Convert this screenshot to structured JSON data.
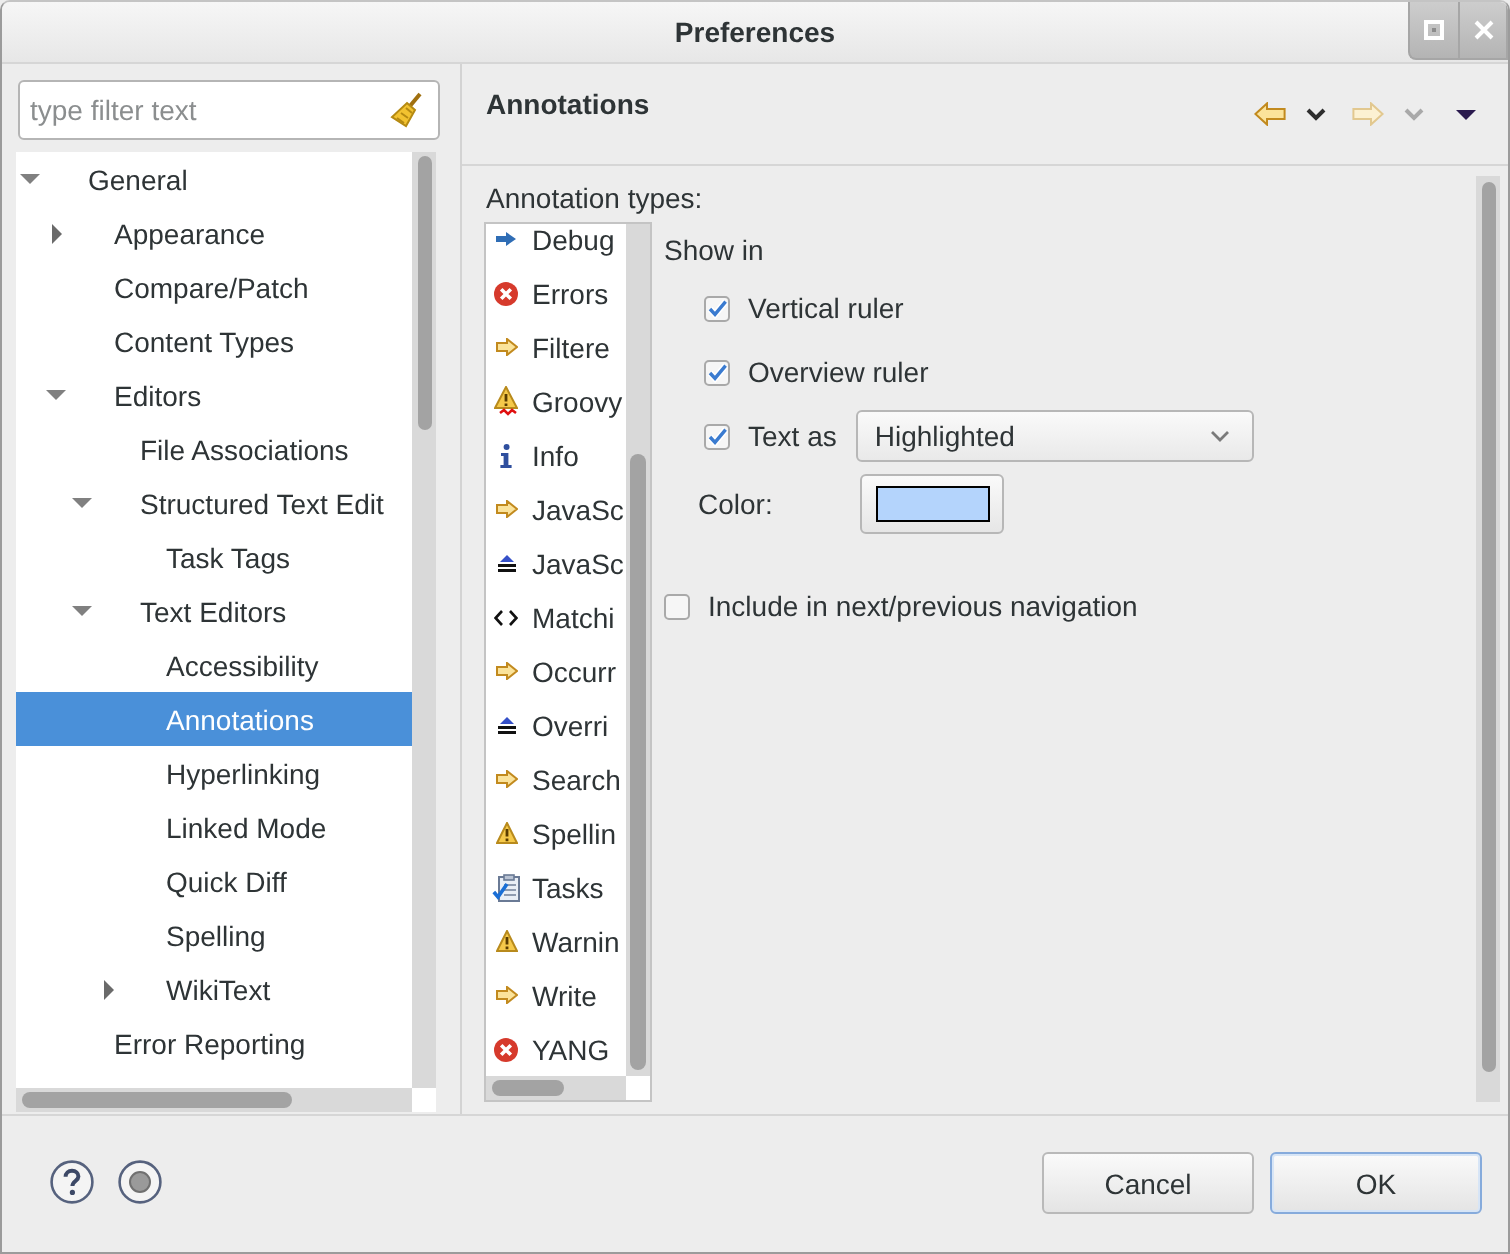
{
  "window": {
    "title": "Preferences"
  },
  "sidebar": {
    "filter": {
      "placeholder": "type filter text"
    },
    "tree": [
      {
        "label": "General",
        "expanded": true,
        "selected": false,
        "children": [
          {
            "label": "Appearance",
            "expanded": false,
            "selected": false
          },
          {
            "label": "Compare/Patch",
            "selected": false
          },
          {
            "label": "Content Types",
            "selected": false
          },
          {
            "label": "Editors",
            "expanded": true,
            "selected": false,
            "children": [
              {
                "label": "File Associations",
                "selected": false
              },
              {
                "label": "Structured Text Edit",
                "expanded": true,
                "selected": false,
                "children": [
                  {
                    "label": "Task Tags",
                    "selected": false
                  }
                ]
              },
              {
                "label": "Text Editors",
                "expanded": true,
                "selected": false,
                "children": [
                  {
                    "label": "Accessibility",
                    "selected": false
                  },
                  {
                    "label": "Annotations",
                    "selected": true
                  },
                  {
                    "label": "Hyperlinking",
                    "selected": false
                  },
                  {
                    "label": "Linked Mode",
                    "selected": false
                  },
                  {
                    "label": "Quick Diff",
                    "selected": false
                  },
                  {
                    "label": "Spelling",
                    "selected": false
                  },
                  {
                    "label": "WikiText",
                    "expanded": false,
                    "selected": false
                  }
                ]
              }
            ]
          },
          {
            "label": "Error Reporting",
            "selected": false
          }
        ]
      }
    ]
  },
  "page": {
    "title": "Annotations",
    "nav": [
      {
        "kind": "back",
        "disabled": false
      },
      {
        "kind": "history",
        "disabled": false
      },
      {
        "kind": "forward",
        "disabled": true
      },
      {
        "kind": "history",
        "disabled": true
      },
      {
        "kind": "menu",
        "disabled": false
      }
    ],
    "list_label": "Annotation types:",
    "annotation_types": [
      {
        "label": "Debug",
        "kind": "debug",
        "selected": false
      },
      {
        "label": "Errors",
        "kind": "error",
        "selected": false
      },
      {
        "label": "Filtere",
        "kind": "arrow",
        "selected": false
      },
      {
        "label": "Groovy",
        "kind": "groovy",
        "selected": false
      },
      {
        "label": "Info",
        "kind": "info",
        "selected": false
      },
      {
        "label": "JavaSc",
        "kind": "arrow",
        "selected": false
      },
      {
        "label": "JavaSc",
        "kind": "marker",
        "selected": false
      },
      {
        "label": "Matchi",
        "kind": "brackets",
        "selected": false
      },
      {
        "label": "Occurr",
        "kind": "arrow",
        "selected": false
      },
      {
        "label": "Overri",
        "kind": "marker",
        "selected": false
      },
      {
        "label": "Search",
        "kind": "arrow",
        "selected": false
      },
      {
        "label": "Spellin",
        "kind": "warning",
        "selected": false
      },
      {
        "label": "Tasks",
        "kind": "tasks",
        "selected": false
      },
      {
        "label": "Warnin",
        "kind": "warning",
        "selected": false
      },
      {
        "label": "Write",
        "kind": "arrow",
        "selected": false
      },
      {
        "label": "YANG",
        "kind": "error",
        "selected": false
      }
    ],
    "show_in_label": "Show in",
    "options": [
      {
        "kind": "checkbox",
        "label": "Vertical ruler",
        "checked": true
      },
      {
        "kind": "checkbox",
        "label": "Overview ruler",
        "checked": true
      },
      {
        "kind": "combo",
        "label": "Text as",
        "checked": true,
        "value": "Highlighted"
      },
      {
        "kind": "color",
        "label": "Color:",
        "color": "#b4d4fc"
      }
    ],
    "navigation_option": {
      "label": "Include in next/previous navigation",
      "checked": false
    }
  },
  "footer": {
    "buttons": [
      {
        "label": "Cancel",
        "default": false
      },
      {
        "label": "OK",
        "default": true
      }
    ]
  }
}
